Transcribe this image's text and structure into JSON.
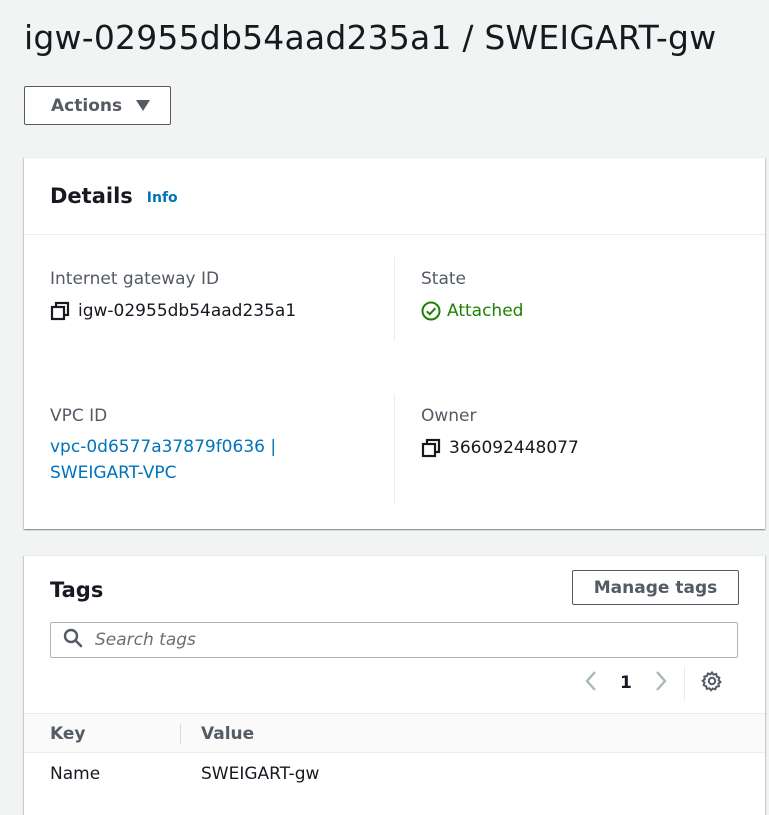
{
  "page": {
    "title": "igw-02955db54aad235a1 / SWEIGART-gw",
    "actions_label": "Actions"
  },
  "details": {
    "title": "Details",
    "info_label": "Info",
    "gateway_id_label": "Internet gateway ID",
    "gateway_id_value": "igw-02955db54aad235a1",
    "state_label": "State",
    "state_value": "Attached",
    "vpc_label": "VPC ID",
    "vpc_value_line1": "vpc-0d6577a37879f0636 |",
    "vpc_value_line2": "SWEIGART-VPC",
    "owner_label": "Owner",
    "owner_value": "366092448077",
    "status_color": "#1d8102",
    "link_color": "#0073bb"
  },
  "tags": {
    "title": "Tags",
    "manage_label": "Manage tags",
    "search_placeholder": "Search tags",
    "page_number": "1",
    "columns": [
      "Key",
      "Value"
    ],
    "rows": [
      {
        "key": "Name",
        "value": "SWEIGART-gw"
      }
    ]
  }
}
